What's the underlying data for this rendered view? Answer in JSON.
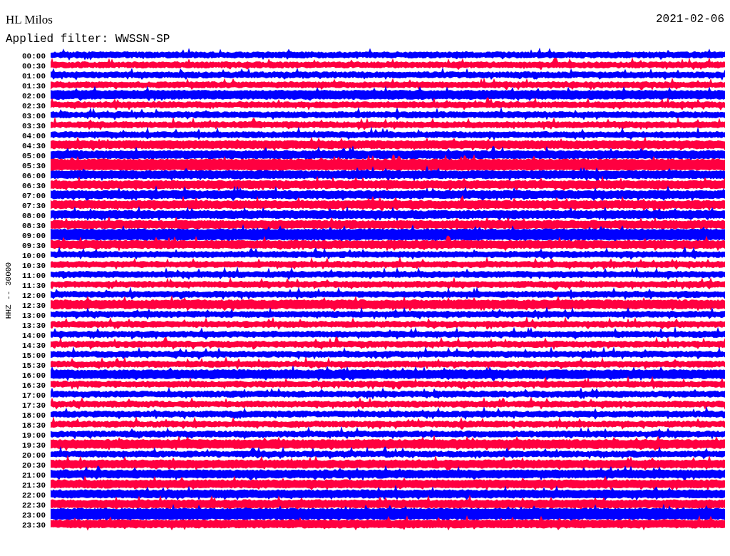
{
  "header": {
    "station": "HL Milos",
    "date": "2021-02-06",
    "filter": "Applied filter: WWSSN-SP"
  },
  "axis_label": "HHZ -- 30000",
  "rows": [
    {
      "time": "00:00",
      "color": "#0000ff"
    },
    {
      "time": "00:30",
      "color": "#ff0040"
    },
    {
      "time": "01:00",
      "color": "#0000ff"
    },
    {
      "time": "01:30",
      "color": "#ff0040"
    },
    {
      "time": "02:00",
      "color": "#0000ff"
    },
    {
      "time": "02:30",
      "color": "#ff0040"
    },
    {
      "time": "03:00",
      "color": "#0000ff"
    },
    {
      "time": "03:30",
      "color": "#ff0040"
    },
    {
      "time": "04:00",
      "color": "#0000ff"
    },
    {
      "time": "04:30",
      "color": "#ff0040"
    },
    {
      "time": "05:00",
      "color": "#0000ff"
    },
    {
      "time": "05:30",
      "color": "#ff0040"
    },
    {
      "time": "06:00",
      "color": "#0000ff"
    },
    {
      "time": "06:30",
      "color": "#ff0040"
    },
    {
      "time": "07:00",
      "color": "#0000ff"
    },
    {
      "time": "07:30",
      "color": "#ff0040"
    },
    {
      "time": "08:00",
      "color": "#0000ff"
    },
    {
      "time": "08:30",
      "color": "#ff0040"
    },
    {
      "time": "09:00",
      "color": "#0000ff"
    },
    {
      "time": "09:30",
      "color": "#ff0040"
    },
    {
      "time": "10:00",
      "color": "#0000ff"
    },
    {
      "time": "10:30",
      "color": "#ff0040"
    },
    {
      "time": "11:00",
      "color": "#0000ff"
    },
    {
      "time": "11:30",
      "color": "#ff0040"
    },
    {
      "time": "12:00",
      "color": "#0000ff"
    },
    {
      "time": "12:30",
      "color": "#ff0040"
    },
    {
      "time": "13:00",
      "color": "#0000ff"
    },
    {
      "time": "13:30",
      "color": "#ff0040"
    },
    {
      "time": "14:00",
      "color": "#0000ff"
    },
    {
      "time": "14:30",
      "color": "#ff0040"
    },
    {
      "time": "15:00",
      "color": "#0000ff"
    },
    {
      "time": "15:30",
      "color": "#ff0040"
    },
    {
      "time": "16:00",
      "color": "#0000ff"
    },
    {
      "time": "16:30",
      "color": "#ff0040"
    },
    {
      "time": "17:00",
      "color": "#0000ff"
    },
    {
      "time": "17:30",
      "color": "#ff0040"
    },
    {
      "time": "18:00",
      "color": "#0000ff"
    },
    {
      "time": "18:30",
      "color": "#ff0040"
    },
    {
      "time": "19:00",
      "color": "#0000ff"
    },
    {
      "time": "19:30",
      "color": "#ff0040"
    },
    {
      "time": "20:00",
      "color": "#0000ff"
    },
    {
      "time": "20:30",
      "color": "#ff0040"
    },
    {
      "time": "21:00",
      "color": "#0000ff"
    },
    {
      "time": "21:30",
      "color": "#ff0040"
    },
    {
      "time": "22:00",
      "color": "#0000ff"
    },
    {
      "time": "22:30",
      "color": "#ff0040"
    },
    {
      "time": "23:00",
      "color": "#0000ff"
    },
    {
      "time": "23:30",
      "color": "#ff0040"
    }
  ]
}
